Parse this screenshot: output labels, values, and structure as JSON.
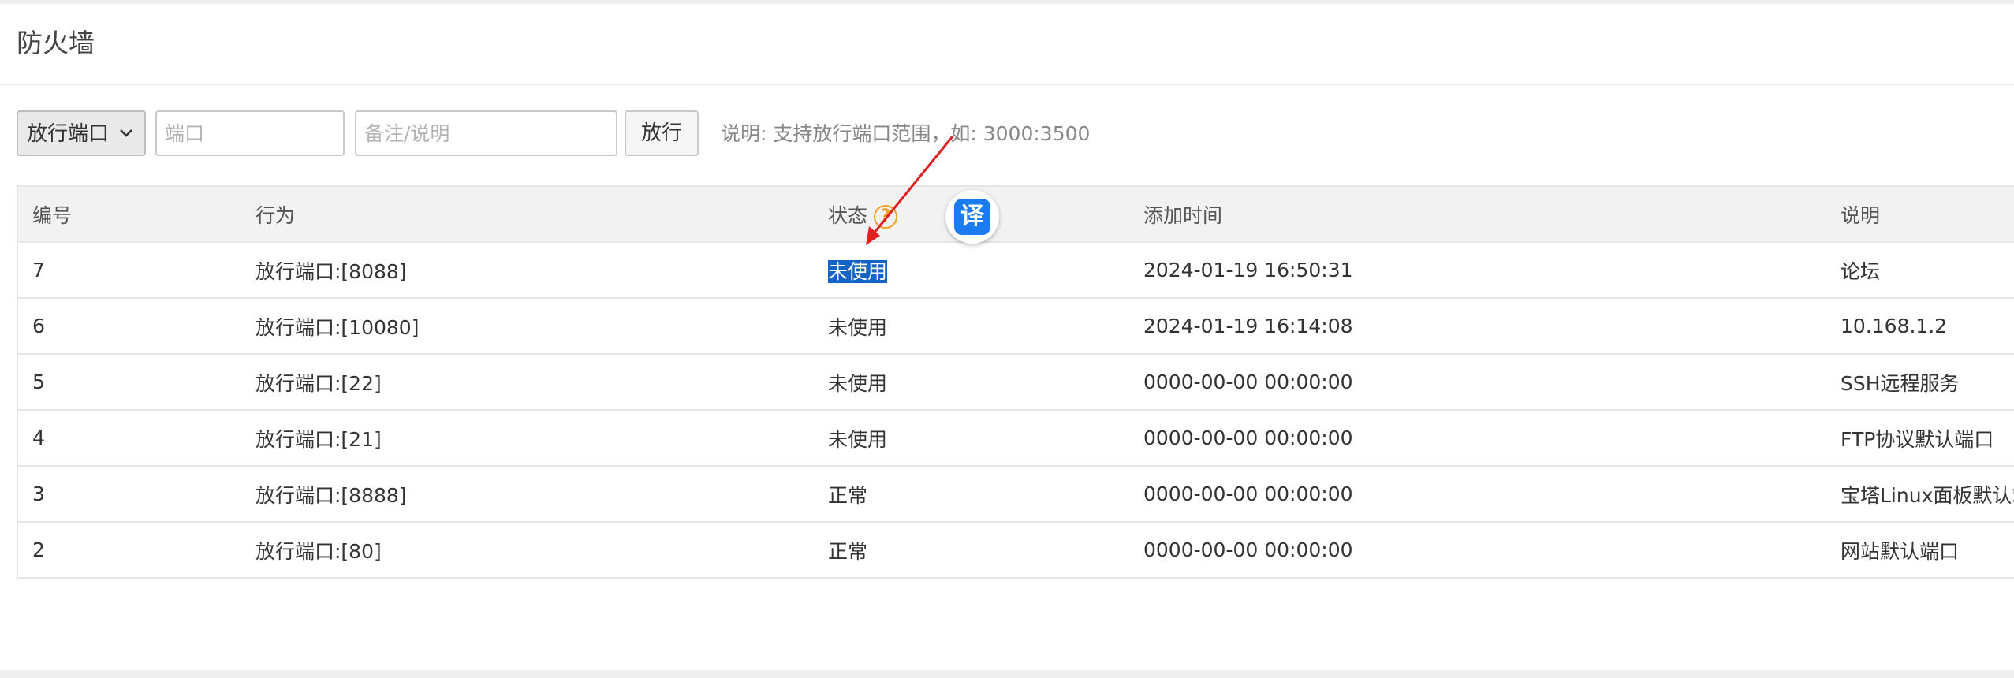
{
  "page": {
    "title": "防火墙"
  },
  "toolbar": {
    "rule_type_selected": "放行端口",
    "port_placeholder": "端口",
    "note_placeholder": "备注/说明",
    "allow_button": "放行",
    "hint": "说明: 支持放行端口范围，如: 3000:3500"
  },
  "table": {
    "columns": [
      "编号",
      "行为",
      "状态",
      "添加时间",
      "说明"
    ],
    "rows": [
      {
        "id": "7",
        "action": "放行端口:[8088]",
        "status": "未使用",
        "time": "2024-01-19 16:50:31",
        "note": "论坛"
      },
      {
        "id": "6",
        "action": "放行端口:[10080]",
        "status": "未使用",
        "time": "2024-01-19 16:14:08",
        "note": "10.168.1.2"
      },
      {
        "id": "5",
        "action": "放行端口:[22]",
        "status": "未使用",
        "time": "0000-00-00 00:00:00",
        "note": "SSH远程服务"
      },
      {
        "id": "4",
        "action": "放行端口:[21]",
        "status": "未使用",
        "time": "0000-00-00 00:00:00",
        "note": "FTP协议默认端口"
      },
      {
        "id": "3",
        "action": "放行端口:[8888]",
        "status": "正常",
        "time": "0000-00-00 00:00:00",
        "note": "宝塔Linux面板默认端口"
      },
      {
        "id": "2",
        "action": "放行端口:[80]",
        "status": "正常",
        "time": "0000-00-00 00:00:00",
        "note": "网站默认端口"
      }
    ]
  },
  "icons": {
    "help": "question-circle-icon",
    "translate": "translate-icon",
    "translate_glyph": "译",
    "help_glyph": "?"
  },
  "colors": {
    "help_icon": "#f0a020",
    "selection": "#1464c8",
    "translate_badge": "#1a7cf0",
    "arrow": "#e02020"
  }
}
